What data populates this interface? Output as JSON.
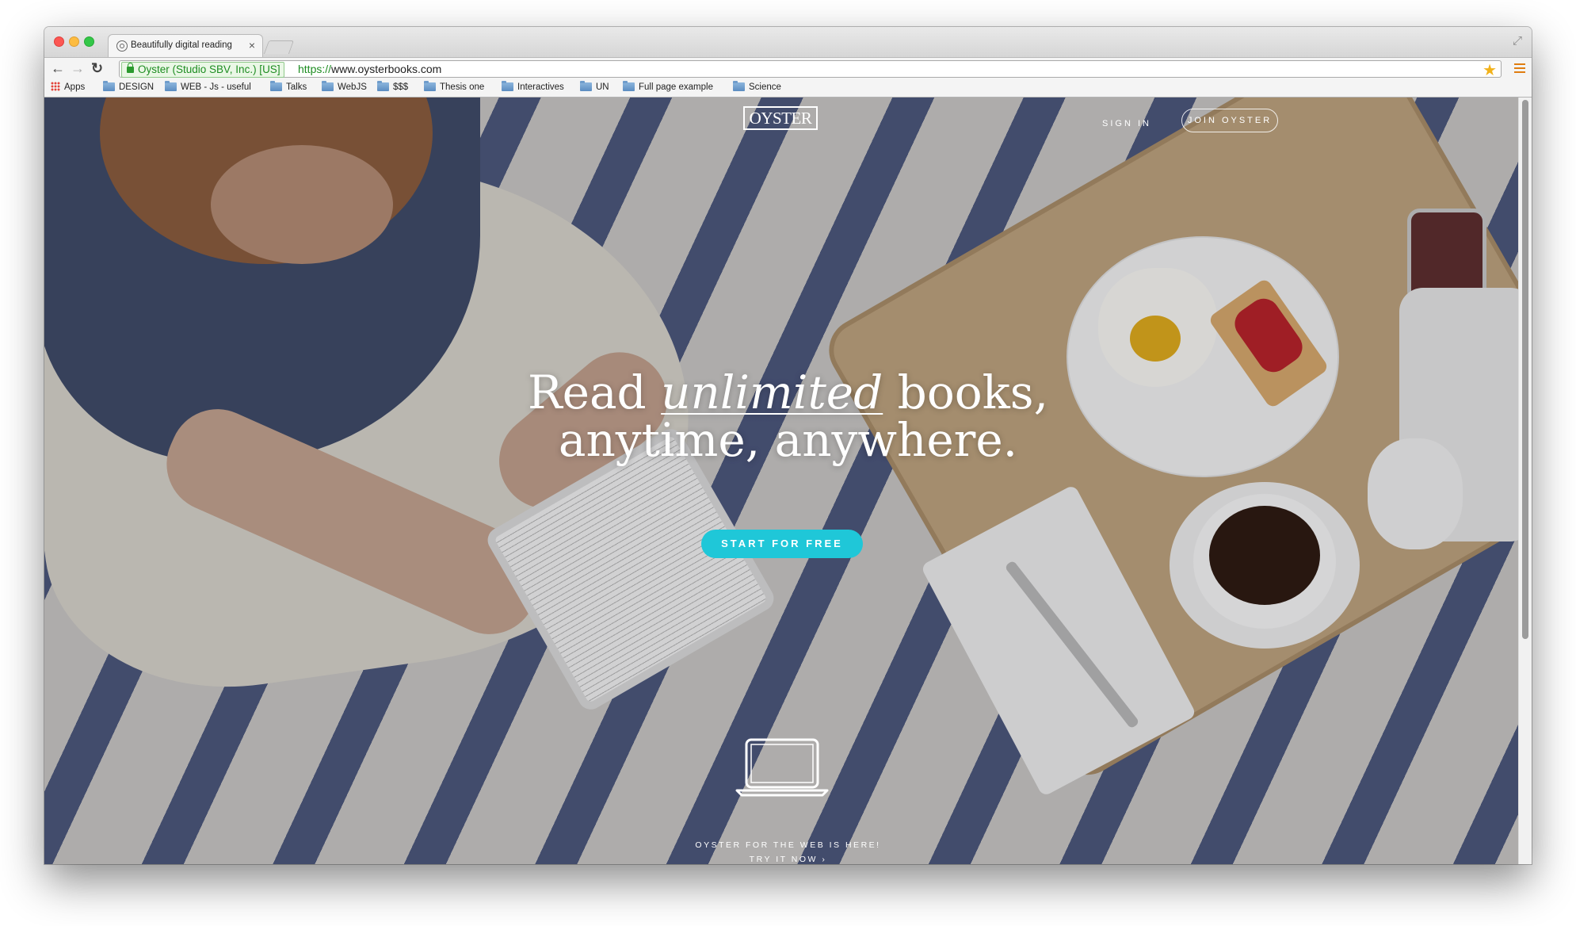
{
  "browser": {
    "tab_title": "Beautifully digital reading",
    "tab_close": "×",
    "ev_name": "Oyster (Studio SBV, Inc.) [US]",
    "url_scheme": "https://",
    "url_rest": "www.oysterbooks.com",
    "nav_back": "←",
    "nav_forward": "→",
    "nav_reload": "↻",
    "star": "★",
    "fullscreen": "⤢"
  },
  "bookmarks": [
    {
      "label": "Apps",
      "icon": "apps-grid-icon"
    },
    {
      "label": "DESIGN",
      "icon": "folder-icon"
    },
    {
      "label": "WEB - Js - useful",
      "icon": "folder-icon"
    },
    {
      "label": "Talks",
      "icon": "folder-icon"
    },
    {
      "label": "WebJS",
      "icon": "folder-icon"
    },
    {
      "label": "$$$",
      "icon": "folder-icon"
    },
    {
      "label": "Thesis one",
      "icon": "folder-icon"
    },
    {
      "label": "Interactives",
      "icon": "folder-icon"
    },
    {
      "label": "UN",
      "icon": "folder-icon"
    },
    {
      "label": "Full page example",
      "icon": "folder-icon"
    },
    {
      "label": "Science",
      "icon": "folder-icon"
    }
  ],
  "site": {
    "logo": "OYSTER",
    "sign_in": "SIGN IN",
    "join": "JOIN OYSTER",
    "hero_line1_pre": "Read ",
    "hero_line1_em": "unlimited",
    "hero_line1_post": " books,",
    "hero_line2": "anytime, anywhere.",
    "cta": "START FOR FREE",
    "web_note": "OYSTER FOR THE WEB IS HERE!",
    "web_try": "TRY IT NOW ›",
    "cta_color": "#1fc7d8"
  }
}
